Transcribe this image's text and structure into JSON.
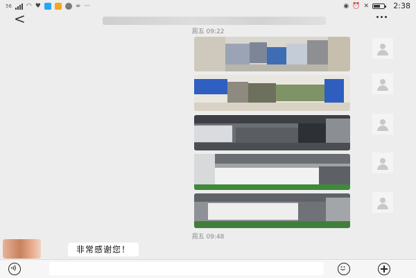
{
  "status_bar": {
    "network_label": "56",
    "time": "2:38",
    "app_icon_colors": [
      "#2aa4f4",
      "#f5a623",
      "#7b7b7b"
    ]
  },
  "header": {
    "back_icon": "back-arrow-icon",
    "more_icon": "more-dots-icon"
  },
  "messages": [
    {
      "type": "timestamp",
      "text": "周五 09:22"
    },
    {
      "type": "image",
      "sender": "self",
      "description_icon": "photo"
    },
    {
      "type": "image",
      "sender": "self",
      "description_icon": "photo"
    },
    {
      "type": "image",
      "sender": "self",
      "description_icon": "photo"
    },
    {
      "type": "image",
      "sender": "self",
      "description_icon": "photo"
    },
    {
      "type": "image",
      "sender": "self",
      "description_icon": "photo"
    },
    {
      "type": "timestamp",
      "text": "周五 09:48"
    },
    {
      "type": "text",
      "sender": "other",
      "text": "非常感谢您！"
    }
  ],
  "input_bar": {
    "voice_icon": "voice-icon",
    "emoji_icon": "emoji-icon",
    "plus_icon": "plus-icon",
    "input_value": ""
  },
  "colors": {
    "background": "#ededed",
    "bubble": "#ffffff",
    "timestamp_text": "#888888"
  }
}
